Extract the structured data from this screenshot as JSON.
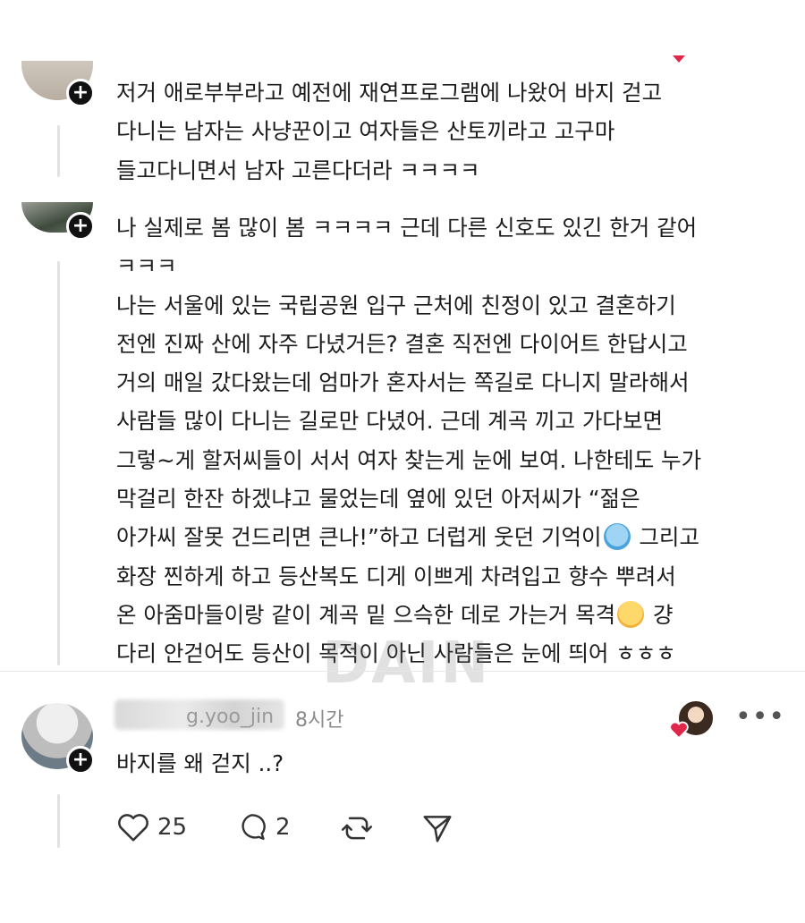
{
  "comments": [
    {
      "lines": [
        "저거 애로부부라고 예전에 재연프로그램에 나왔어 바지 걷고",
        "다니는 남자는 사냥꾼이고 여자들은 산토끼라고 고구마",
        "들고다니면서 남자 고른다더라 ㅋㅋㅋㅋ"
      ]
    },
    {
      "lines": [
        "나 실제로 봄 많이 봄 ㅋㅋㅋㅋ 근데 다른 신호도 있긴 한거 같어",
        "ㅋㅋㅋ",
        "나는 서울에 있는 국립공원 입구 근처에 친정이 있고 결혼하기",
        "전엔 진짜 산에 자주 다녔거든? 결혼 직전엔 다이어트 한답시고",
        "거의 매일 갔다왔는데 엄마가 혼자서는 쪽길로 다니지 말라해서",
        "사람들 많이 다니는 길로만 다녔어. 근데 계곡 끼고 가다보면",
        "그렇~게 할저씨들이 서서 여자 찾는게 눈에 보여. 나한테도 누가",
        "막걸리 한잔 하겠냐고 물었는데 옆에 있던 아저씨가 “젊은",
        "아가씨 잘못 건드리면 큰나!”하고 더럽게 웃던 기억이",
        "그리고",
        "화장 찐하게 하고 등산복도 디게 이쁘게 차려입고 향수 뿌려서",
        "온 아줌마들이랑 같이 계곡 밑 으슥한 데로 가는거 목격",
        "걍",
        "다리 안걷어도 등산이 목적이 아닌 사람들은 눈에 띄어 ㅎㅎㅎ"
      ]
    }
  ],
  "watermark": "DAIN",
  "reply": {
    "username_tail": "g.yoo_jin",
    "time": "8시간",
    "text": "바지를 왜 걷지 ..?",
    "likes": "25",
    "replies": "2"
  },
  "icons": {
    "follow": "plus-icon",
    "more": "more-horizontal-icon",
    "like": "heart-icon",
    "comment": "comment-icon",
    "repost": "repost-icon",
    "share": "send-icon"
  },
  "colors": {
    "heart": "#e0264a"
  }
}
